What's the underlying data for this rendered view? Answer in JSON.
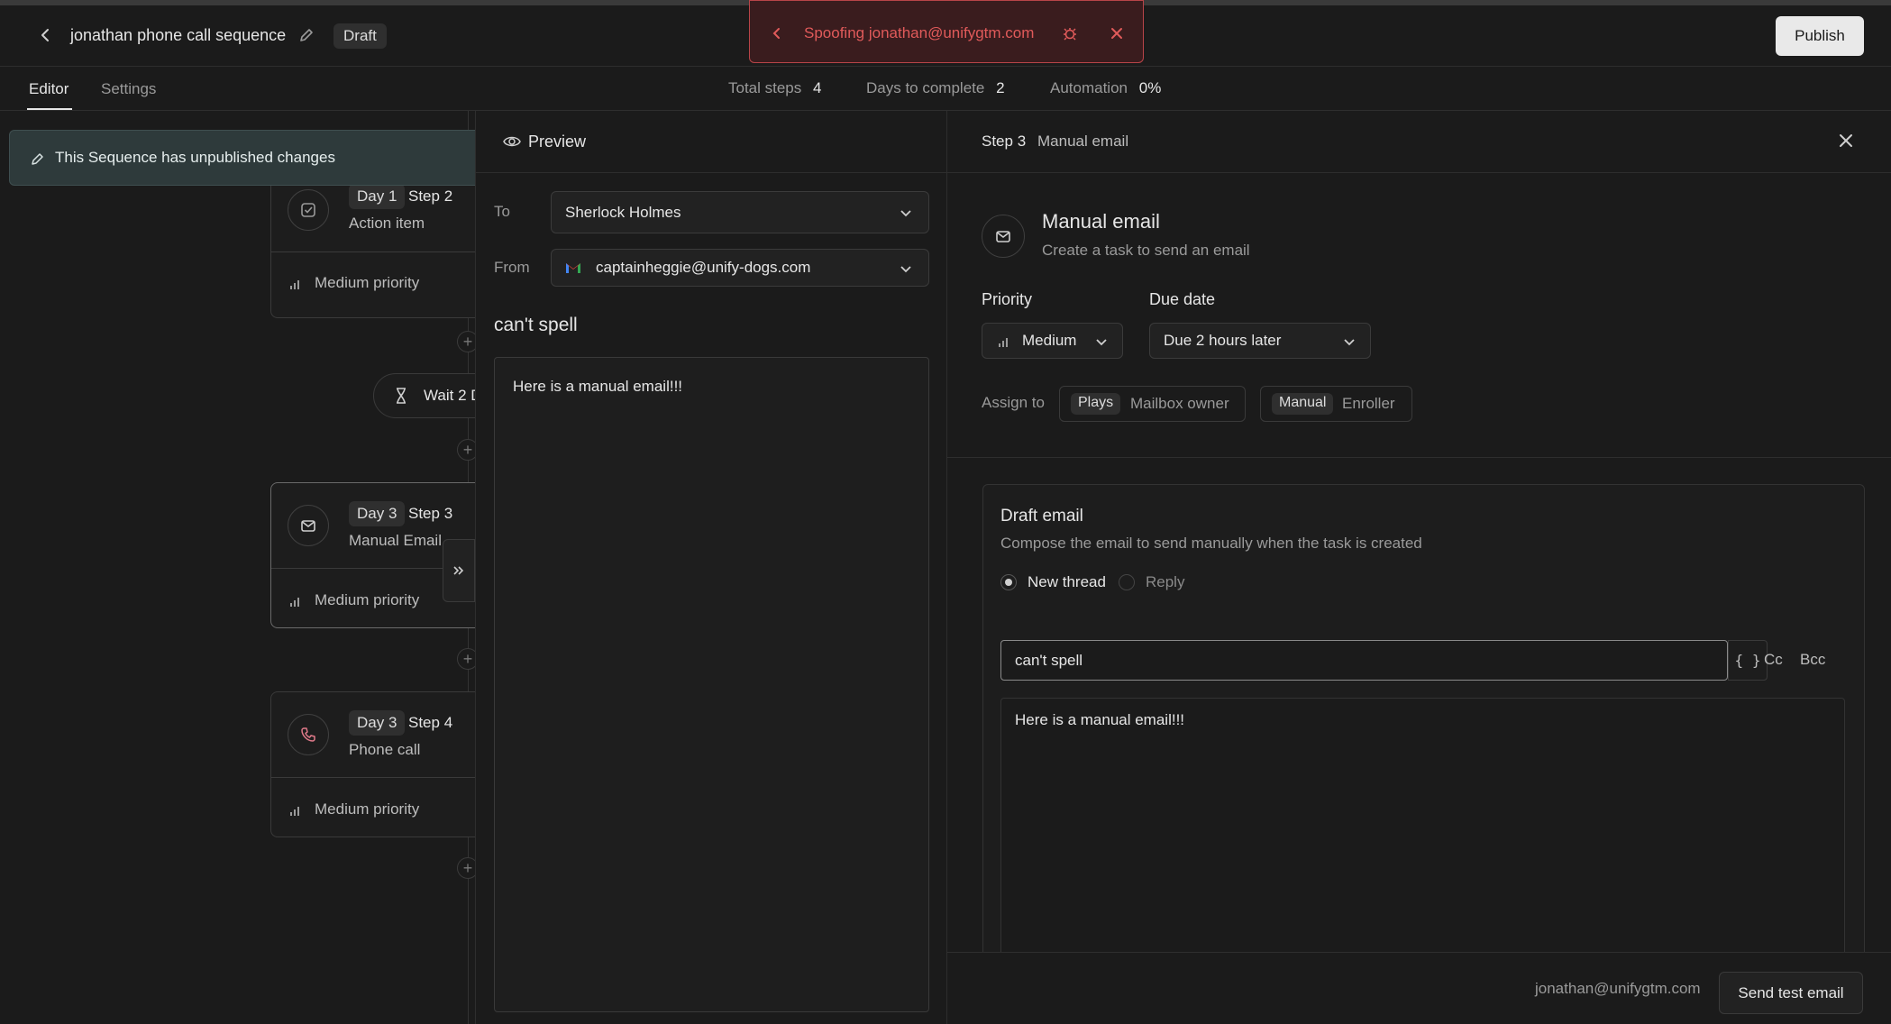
{
  "header": {
    "sequence_name": "jonathan phone call sequence",
    "status_badge": "Draft",
    "spoof_banner": "Spoofing jonathan@unifygtm.com",
    "publish_label": "Publish"
  },
  "tabs": [
    "Editor",
    "Settings"
  ],
  "stats": {
    "total_steps_label": "Total steps",
    "total_steps_value": "4",
    "days_label": "Days to complete",
    "days_value": "2",
    "automation_label": "Automation",
    "automation_value": "0%"
  },
  "notice": "This Sequence has unpublished changes",
  "steps": [
    {
      "day": "Day 1",
      "step": "Step 2",
      "type": "Action item",
      "priority": "Medium priority"
    },
    {
      "day": "Day 3",
      "step": "Step 3",
      "type": "Manual Email",
      "priority": "Medium priority"
    },
    {
      "day": "Day 3",
      "step": "Step 4",
      "type": "Phone call",
      "priority": "Medium priority"
    }
  ],
  "wait_label": "Wait 2 D",
  "preview": {
    "title": "Preview",
    "to_label": "To",
    "to_value": "Sherlock Holmes",
    "from_label": "From",
    "from_value": "captainheggie@unify-dogs.com",
    "subject": "can't spell",
    "body": "Here is a manual email!!!"
  },
  "editor": {
    "step_label": "Step 3",
    "step_type": "Manual email",
    "title": "Manual email",
    "subtitle": "Create a task to send an email",
    "priority_label": "Priority",
    "priority_value": "Medium",
    "due_label": "Due date",
    "due_value": "Due 2 hours later",
    "assign_label": "Assign to",
    "assign_tag_1": "Plays",
    "assign_value_1": "Mailbox owner",
    "assign_tag_2": "Manual",
    "assign_value_2": "Enroller",
    "draft_title": "Draft email",
    "draft_subtitle": "Compose the email to send manually when the task is created",
    "radio_new": "New thread",
    "radio_reply": "Reply",
    "subject_value": "can't spell",
    "variables_label": "{ }",
    "cc_label": "Cc",
    "bcc_label": "Bcc",
    "body_value": "Here is a manual email!!!",
    "footer_email": "jonathan@unifygtm.com",
    "send_test_label": "Send test email"
  },
  "colors": {
    "background": "#1b1b1b",
    "spoof_red": "#e05a5a",
    "spoof_bg": "#3a1c1e"
  }
}
